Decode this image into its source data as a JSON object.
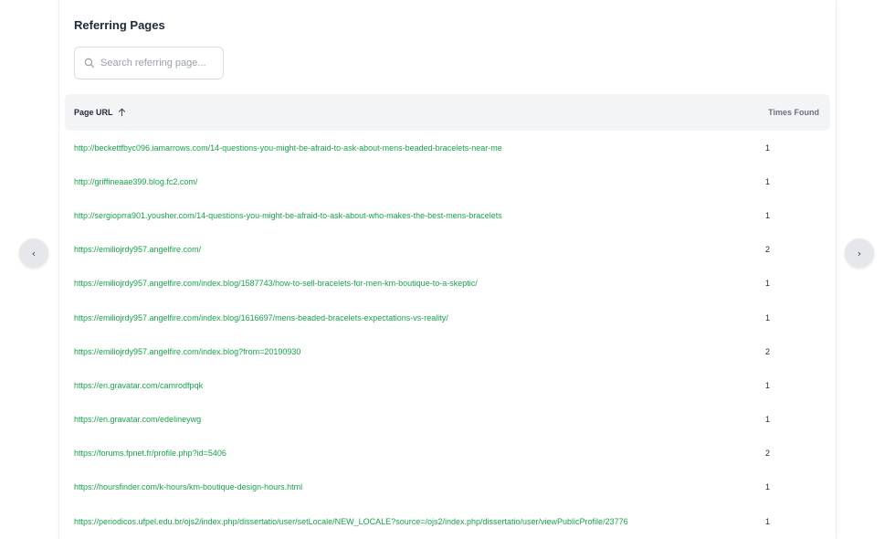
{
  "panel": {
    "title": "Referring Pages"
  },
  "search": {
    "placeholder": "Search referring page..."
  },
  "table": {
    "columns": {
      "url": "Page URL",
      "count": "Times Found"
    },
    "sort_direction": "ascending",
    "rows": [
      {
        "url": "http://beckettfbyc096.iamarrows.com/14-questions-you-might-be-afraid-to-ask-about-mens-beaded-bracelets-near-me",
        "count": "1"
      },
      {
        "url": "http://griffineaae399.blog.fc2.com/",
        "count": "1"
      },
      {
        "url": "http://sergioprra901.yousher.com/14-questions-you-might-be-afraid-to-ask-about-who-makes-the-best-mens-bracelets",
        "count": "1"
      },
      {
        "url": "https://emiliojrdy957.angelfire.com/",
        "count": "2"
      },
      {
        "url": "https://emiliojrdy957.angelfire.com/index.blog/1587743/how-to-sell-bracelets-for-men-km-boutique-to-a-skeptic/",
        "count": "1"
      },
      {
        "url": "https://emiliojrdy957.angelfire.com/index.blog/1616697/mens-beaded-bracelets-expectations-vs-reality/",
        "count": "1"
      },
      {
        "url": "https://emiliojrdy957.angelfire.com/index.blog?from=20190930",
        "count": "2"
      },
      {
        "url": "https://en.gravatar.com/camrodfpqk",
        "count": "1"
      },
      {
        "url": "https://en.gravatar.com/edelineywg",
        "count": "1"
      },
      {
        "url": "https://forums.fpnet.fr/profile.php?id=5406",
        "count": "2"
      },
      {
        "url": "https://hoursfinder.com/k-hours/km-boutique-design-hours.html",
        "count": "1"
      },
      {
        "url": "https://periodicos.ufpel.edu.br/ojs2/index.php/dissertatio/user/setLocale/NEW_LOCALE?source=/ojs2/index.php/dissertatio/user/viewPublicProfile/23776",
        "count": "1"
      }
    ]
  },
  "navigation": {
    "prev_glyph": "‹",
    "next_glyph": "›"
  },
  "colors": {
    "link": "#16a34a",
    "header_bg": "#f3f4f6",
    "nav_bg": "#e5e7eb"
  },
  "icons": {
    "search": "search-icon",
    "sort": "arrow-up-icon",
    "prev": "chevron-left-icon",
    "next": "chevron-right-icon"
  }
}
